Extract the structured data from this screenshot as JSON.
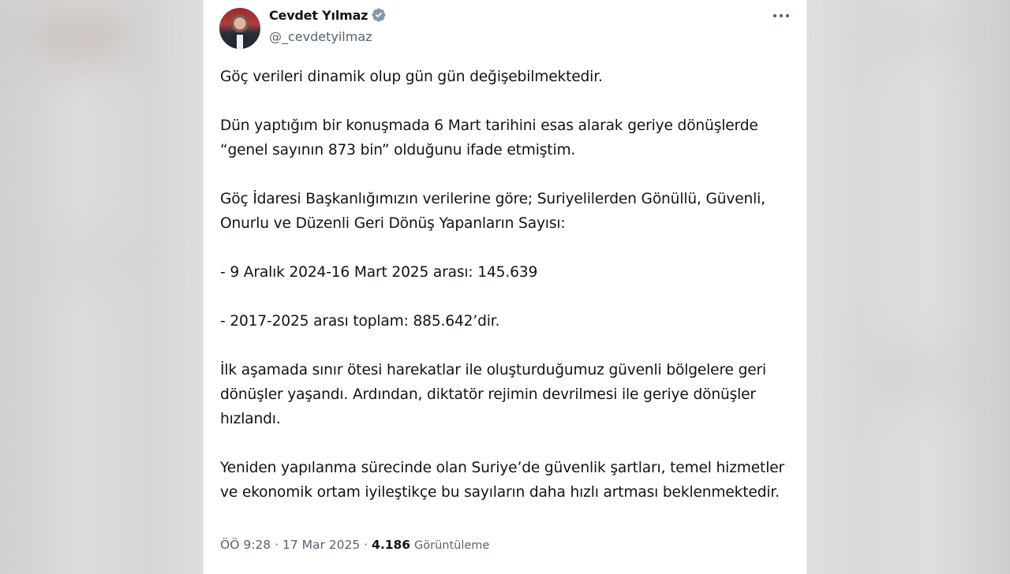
{
  "tweet": {
    "author": {
      "display_name": "Cevdet Yılmaz",
      "handle": "@_cevdetyilmaz",
      "verified": true
    },
    "paragraphs": [
      "Göç verileri dinamik olup gün gün değişebilmektedir.",
      "Dün yaptığım bir konuşmada 6 Mart tarihini esas alarak geriye dönüşlerde “genel sayının 873 bin” olduğunu ifade etmiştim.",
      "Göç İdaresi Başkanlığımızın verilerine göre; Suriyelilerden Gönüllü, Güvenli, Onurlu ve Düzenli Geri Dönüş Yapanların Sayısı:",
      "- 9 Aralık 2024-16 Mart 2025 arası: 145.639",
      "- 2017-2025 arası toplam: 885.642’dir.",
      "İlk aşamada sınır ötesi harekatlar ile oluşturduğumuz güvenli bölgelere geri dönüşler yaşandı. Ardından, diktatör rejimin devrilmesi ile geriye dönüşler hızlandı.",
      "Yeniden yapılanma sürecinde olan Suriye’de güvenlik şartları, temel hizmetler ve ekonomik ortam iyileştikçe bu sayıların daha hızlı artması beklenmektedir."
    ],
    "meta": {
      "time": "ÖÖ 9:28",
      "separator": "·",
      "date": "17 Mar 2025",
      "views_count": "4.186",
      "views_label": "Görüntüleme"
    }
  },
  "icons": {
    "verified": "verified-badge-icon",
    "more": "more-options-icon"
  },
  "colors": {
    "text_primary": "#0f1419",
    "text_secondary": "#536471",
    "verified_badge": "#829aab",
    "card_background": "#ffffff"
  }
}
